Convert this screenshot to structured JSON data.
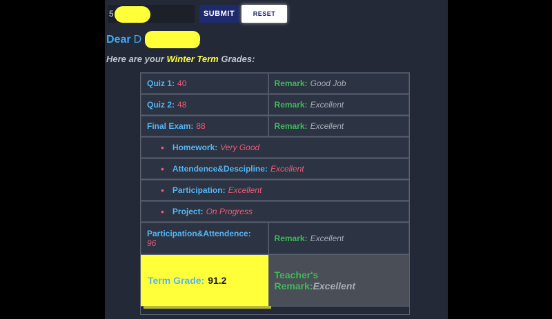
{
  "form": {
    "id_prefix": "5",
    "submit_label": "SUBMIT",
    "reset_label": "RESET"
  },
  "greeting": {
    "dear": "Dear",
    "name_initial": "D",
    "comma": ","
  },
  "subtitle": {
    "before": "Here are your",
    "term": "Winter Term",
    "after": "Grades:"
  },
  "grades": {
    "quiz1": {
      "label": "Quiz 1:",
      "score": "40",
      "remark_label": "Remark:",
      "remark": "Good Job"
    },
    "quiz2": {
      "label": "Quiz 2:",
      "score": "48",
      "remark_label": "Remark:",
      "remark": "Excellent"
    },
    "final": {
      "label": "Final Exam:",
      "score": "88",
      "remark_label": "Remark:",
      "remark": "Excellent"
    },
    "items": [
      {
        "label": "Homework:",
        "value": "Very Good"
      },
      {
        "label": "Attendence&Descipline:",
        "value": "Excellent"
      },
      {
        "label": "Participation:",
        "value": "Excellent"
      },
      {
        "label": "Project:",
        "value": "On Progress"
      }
    ],
    "part_att": {
      "label": "Participation&Attendence:",
      "score": "96",
      "remark_label": "Remark:",
      "remark": "Excellent"
    },
    "term_grade": {
      "label": "Term Grade:",
      "value": "91.2"
    },
    "teacher": {
      "label_line1": "Teacher's",
      "label_line2": "Remark:",
      "remark": "Excellent"
    }
  },
  "colors": {
    "background": "#232936",
    "label_blue": "#56b6f5",
    "score_pink": "#ef5a77",
    "remark_green": "#3fb95a",
    "highlight_yellow": "#ffff3a",
    "submit_navy": "#1e2a6e"
  }
}
